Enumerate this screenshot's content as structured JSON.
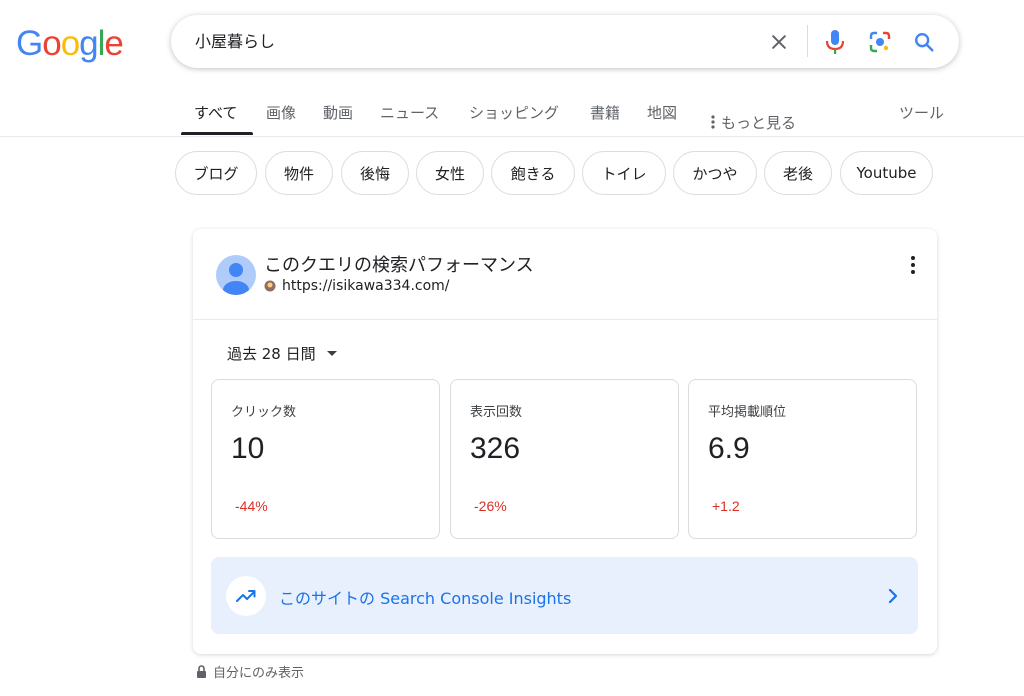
{
  "logo": {
    "letters": [
      {
        "char": "G",
        "color": "#4285f4"
      },
      {
        "char": "o",
        "color": "#ea4335"
      },
      {
        "char": "o",
        "color": "#fbbc05"
      },
      {
        "char": "g",
        "color": "#4285f4"
      },
      {
        "char": "l",
        "color": "#34a853"
      },
      {
        "char": "e",
        "color": "#ea4335"
      }
    ]
  },
  "search": {
    "query": "小屋暮らし",
    "icons": [
      "clear-icon",
      "mic-icon",
      "lens-icon",
      "search-icon"
    ]
  },
  "tabs": {
    "items": [
      {
        "label": "すべて",
        "active": true
      },
      {
        "label": "画像"
      },
      {
        "label": "動画"
      },
      {
        "label": "ニュース"
      },
      {
        "label": "ショッピング"
      },
      {
        "label": "書籍"
      },
      {
        "label": "地図"
      },
      {
        "label": "もっと見る"
      }
    ],
    "tools_label": "ツール"
  },
  "chips": [
    "ブログ",
    "物件",
    "後悔",
    "女性",
    "飽きる",
    "トイレ",
    "かつや",
    "老後",
    "Youtube"
  ],
  "card": {
    "title": "このクエリの検索パフォーマンス",
    "url": "https://isikawa334.com/",
    "period": "過去 28 日間",
    "metrics": [
      {
        "label": "クリック数",
        "value": "10",
        "change": "-44%"
      },
      {
        "label": "表示回数",
        "value": "326",
        "change": "-26%"
      },
      {
        "label": "平均掲載順位",
        "value": "6.9",
        "change": "+1.2"
      }
    ],
    "insights_label": "このサイトの Search Console Insights"
  },
  "footer": {
    "private_note": "自分にのみ表示"
  },
  "colors": {
    "accent": "#1a73e8",
    "negative": "#d93025",
    "insights_bg": "#e8f0fe"
  }
}
